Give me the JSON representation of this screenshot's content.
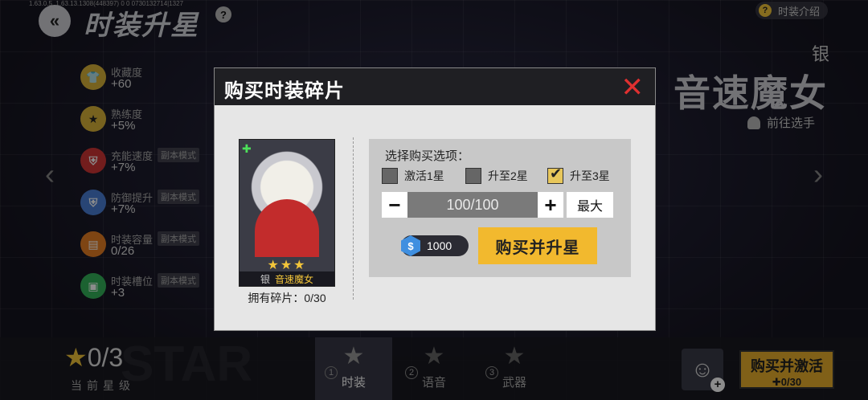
{
  "debug_text": "1.63.0.5_1.63.13.1308(448397) 0 0 0730132714|1327",
  "header": {
    "title": "时装升星",
    "help_icon": "?",
    "intro_icon": "?",
    "intro_label": "时装介绍"
  },
  "stats": [
    {
      "name": "收藏度",
      "value": "+60",
      "tag": "",
      "icon": "shirt-icon"
    },
    {
      "name": "熟练度",
      "value": "+5%",
      "tag": "",
      "icon": "star-badge-icon"
    },
    {
      "name": "充能速度",
      "value": "+7%",
      "tag": "副本模式",
      "icon": "shield-icon"
    },
    {
      "name": "防御提升",
      "value": "+7%",
      "tag": "副本模式",
      "icon": "shield-icon"
    },
    {
      "name": "时装容量",
      "value": "0/26",
      "tag": "副本模式",
      "icon": "capacity-icon"
    },
    {
      "name": "时装槽位",
      "value": "+3",
      "tag": "副本模式",
      "icon": "slot-icon"
    }
  ],
  "character": {
    "grade": "银",
    "name": "音速魔女",
    "goto_player": "前往选手"
  },
  "bottom": {
    "star_count": "0/3",
    "star_label": "当前星级",
    "bg_text": "STAR",
    "tabs": [
      {
        "num": "1",
        "label": "时装"
      },
      {
        "num": "2",
        "label": "语音"
      },
      {
        "num": "3",
        "label": "武器"
      }
    ],
    "buy_activate_label": "购买并激活",
    "buy_activate_count": "0/30"
  },
  "modal": {
    "title": "购买时装碎片",
    "card": {
      "grade": "银",
      "name": "音速魔女",
      "stars": "★★★"
    },
    "owned_label": "拥有碎片：0/30",
    "options_title": "选择购买选项：",
    "options": [
      {
        "label": "激活1星",
        "checked": false
      },
      {
        "label": "升至2星",
        "checked": false
      },
      {
        "label": "升至3星",
        "checked": true
      }
    ],
    "quantity": "100/100",
    "max_label": "最大",
    "minus": "−",
    "plus": "+",
    "coin_symbol": "$",
    "price": "1000",
    "buy_button": "购买并升星"
  }
}
